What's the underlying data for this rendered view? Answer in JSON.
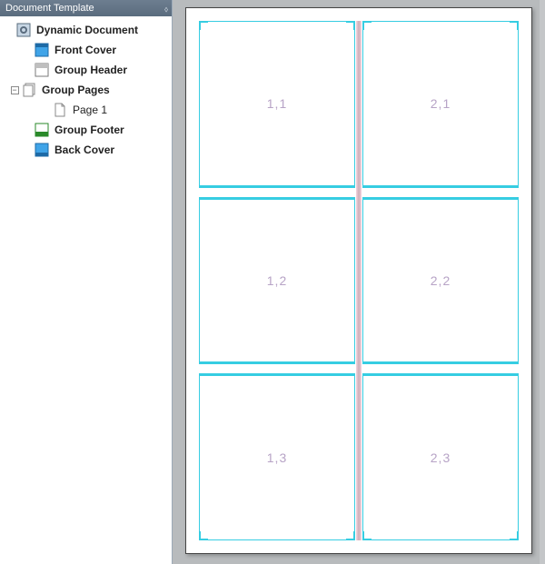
{
  "panel": {
    "title": "Document Template"
  },
  "tree": {
    "root": "Dynamic Document",
    "front_cover": "Front Cover",
    "group_header": "Group Header",
    "group_pages": "Group Pages",
    "page1": "Page 1",
    "group_footer": "Group Footer",
    "back_cover": "Back Cover"
  },
  "cells": {
    "r1c1": "1,1",
    "r1c2": "2,1",
    "r2c1": "1,2",
    "r2c2": "2,2",
    "r3c1": "1,3",
    "r3c2": "2,3"
  },
  "colors": {
    "cell_border": "#36cde2",
    "title_bg_top": "#6d7e90",
    "title_bg_bot": "#5a6c7e",
    "cell_label": "#b7a3c6",
    "spine": "#f7d3de"
  },
  "layout": {
    "columns": 2,
    "rows": 3
  }
}
